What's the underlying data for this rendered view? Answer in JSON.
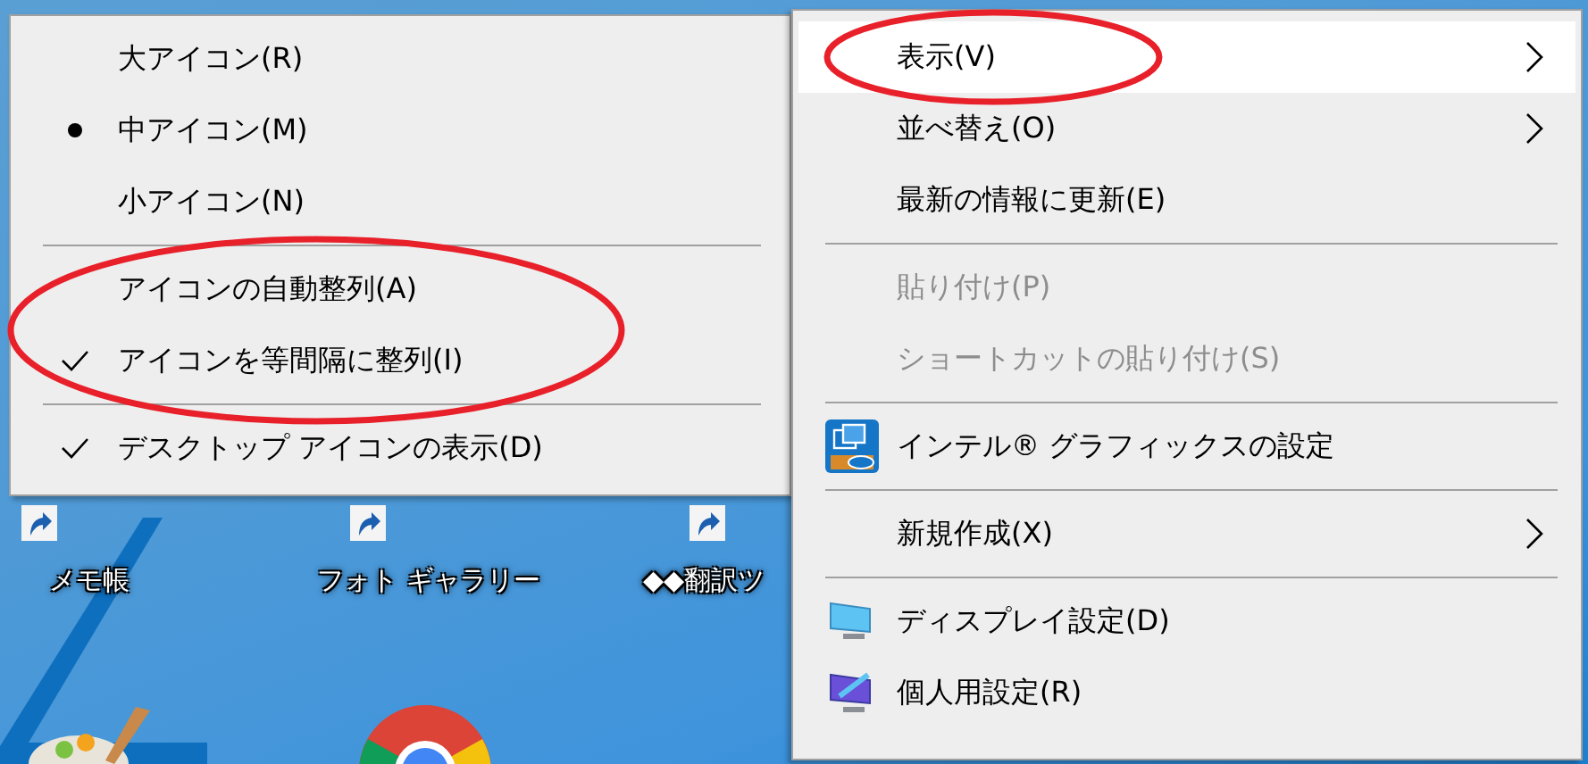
{
  "desktop": {
    "icons": [
      {
        "kind": "shortcut",
        "label": "メモ帳"
      },
      {
        "kind": "shortcut",
        "label": "フォト ギャラリー"
      },
      {
        "kind": "shortcut",
        "label": "◆◆翻訳ツ"
      },
      {
        "kind": "palette"
      },
      {
        "kind": "browser"
      }
    ]
  },
  "view_submenu": {
    "groups": [
      {
        "circled": false,
        "items": [
          {
            "label": "大アイコン(R)",
            "kind": "radio",
            "checked": false
          },
          {
            "label": "中アイコン(M)",
            "kind": "radio",
            "checked": true
          },
          {
            "label": "小アイコン(N)",
            "kind": "radio",
            "checked": false
          }
        ]
      },
      {
        "circled": true,
        "items": [
          {
            "label": "アイコンの自動整列(A)",
            "kind": "check",
            "checked": false
          },
          {
            "label": "アイコンを等間隔に整列(I)",
            "kind": "check",
            "checked": true
          }
        ]
      },
      {
        "circled": false,
        "items": [
          {
            "label": "デスクトップ アイコンの表示(D)",
            "kind": "check",
            "checked": true
          }
        ]
      }
    ]
  },
  "context_menu": {
    "groups": [
      {
        "items": [
          {
            "label": "表示(V)",
            "kind": "plain",
            "submenu": true,
            "selected": true,
            "disabled": false,
            "circled": true
          },
          {
            "label": "並べ替え(O)",
            "kind": "plain",
            "submenu": true,
            "selected": false,
            "disabled": false,
            "circled": false
          },
          {
            "label": "最新の情報に更新(E)",
            "kind": "plain",
            "submenu": false,
            "selected": false,
            "disabled": false,
            "circled": false
          }
        ]
      },
      {
        "items": [
          {
            "label": "貼り付け(P)",
            "kind": "plain",
            "submenu": false,
            "selected": false,
            "disabled": true,
            "circled": false
          },
          {
            "label": "ショートカットの貼り付け(S)",
            "kind": "plain",
            "submenu": false,
            "selected": false,
            "disabled": true,
            "circled": false
          }
        ]
      },
      {
        "items": [
          {
            "label": "インテル® グラフィックスの設定",
            "kind": "graphics",
            "submenu": false,
            "selected": false,
            "disabled": false,
            "circled": false
          }
        ]
      },
      {
        "items": [
          {
            "label": "新規作成(X)",
            "kind": "plain",
            "submenu": true,
            "selected": false,
            "disabled": false,
            "circled": false
          }
        ]
      },
      {
        "items": [
          {
            "label": "ディスプレイ設定(D)",
            "kind": "display",
            "submenu": false,
            "selected": false,
            "disabled": false,
            "circled": false
          },
          {
            "label": "個人用設定(R)",
            "kind": "personalize",
            "submenu": false,
            "selected": false,
            "disabled": false,
            "circled": false
          }
        ]
      }
    ]
  }
}
